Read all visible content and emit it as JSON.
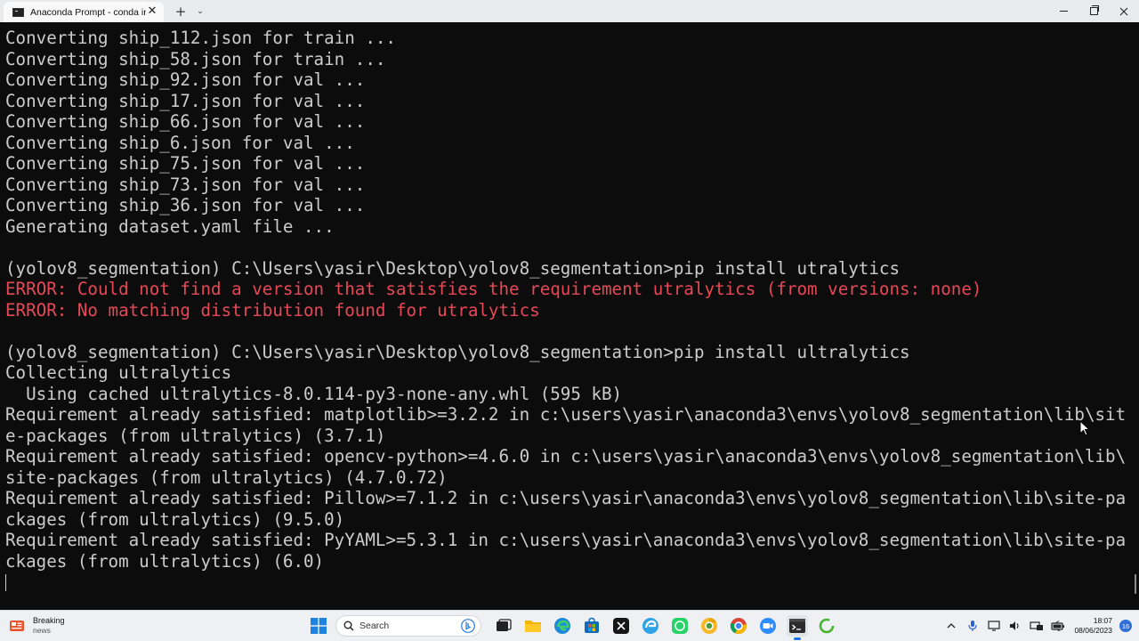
{
  "window": {
    "tab_title": "Anaconda Prompt - conda  in",
    "tab_close": "✕",
    "new_tab": "+",
    "dropdown": "⌄"
  },
  "terminal": {
    "lines": [
      {
        "text": "Converting ship_112.json for train ...",
        "type": "normal"
      },
      {
        "text": "Converting ship_58.json for train ...",
        "type": "normal"
      },
      {
        "text": "Converting ship_92.json for val ...",
        "type": "normal"
      },
      {
        "text": "Converting ship_17.json for val ...",
        "type": "normal"
      },
      {
        "text": "Converting ship_66.json for val ...",
        "type": "normal"
      },
      {
        "text": "Converting ship_6.json for val ...",
        "type": "normal"
      },
      {
        "text": "Converting ship_75.json for val ...",
        "type": "normal"
      },
      {
        "text": "Converting ship_73.json for val ...",
        "type": "normal"
      },
      {
        "text": "Converting ship_36.json for val ...",
        "type": "normal"
      },
      {
        "text": "Generating dataset.yaml file ...",
        "type": "normal"
      },
      {
        "text": "",
        "type": "blank"
      },
      {
        "text": "(yolov8_segmentation) C:\\Users\\yasir\\Desktop\\yolov8_segmentation>pip install utralytics",
        "type": "normal"
      },
      {
        "text": "ERROR: Could not find a version that satisfies the requirement utralytics (from versions: none)",
        "type": "error"
      },
      {
        "text": "ERROR: No matching distribution found for utralytics",
        "type": "error"
      },
      {
        "text": "",
        "type": "blank"
      },
      {
        "text": "(yolov8_segmentation) C:\\Users\\yasir\\Desktop\\yolov8_segmentation>pip install ultralytics",
        "type": "normal"
      },
      {
        "text": "Collecting ultralytics",
        "type": "normal"
      },
      {
        "text": "  Using cached ultralytics-8.0.114-py3-none-any.whl (595 kB)",
        "type": "normal"
      },
      {
        "text": "Requirement already satisfied: matplotlib>=3.2.2 in c:\\users\\yasir\\anaconda3\\envs\\yolov8_segmentation\\lib\\sit",
        "type": "normal"
      },
      {
        "text": "e-packages (from ultralytics) (3.7.1)",
        "type": "normal"
      },
      {
        "text": "Requirement already satisfied: opencv-python>=4.6.0 in c:\\users\\yasir\\anaconda3\\envs\\yolov8_segmentation\\lib\\",
        "type": "normal"
      },
      {
        "text": "site-packages (from ultralytics) (4.7.0.72)",
        "type": "normal"
      },
      {
        "text": "Requirement already satisfied: Pillow>=7.1.2 in c:\\users\\yasir\\anaconda3\\envs\\yolov8_segmentation\\lib\\site-pa",
        "type": "normal"
      },
      {
        "text": "ckages (from ultralytics) (9.5.0)",
        "type": "normal"
      },
      {
        "text": "Requirement already satisfied: PyYAML>=5.3.1 in c:\\users\\yasir\\anaconda3\\envs\\yolov8_segmentation\\lib\\site-pa",
        "type": "normal"
      },
      {
        "text": "ckages (from ultralytics) (6.0)",
        "type": "normal"
      }
    ],
    "colors": {
      "background": "#0c0c0c",
      "foreground": "#cccccc",
      "error": "#e74856"
    }
  },
  "taskbar": {
    "widget": {
      "title": "Breaking",
      "subtitle": "news"
    },
    "search_placeholder": "Search",
    "apps": [
      "task-view",
      "file-explorer",
      "edge",
      "store",
      "github",
      "edge-dev",
      "whatsapp",
      "chrome-canary",
      "chrome",
      "zoom",
      "terminal",
      "loader"
    ],
    "clock": {
      "time": "18:07",
      "date": "08/06/2023"
    },
    "notification_count": "16"
  }
}
